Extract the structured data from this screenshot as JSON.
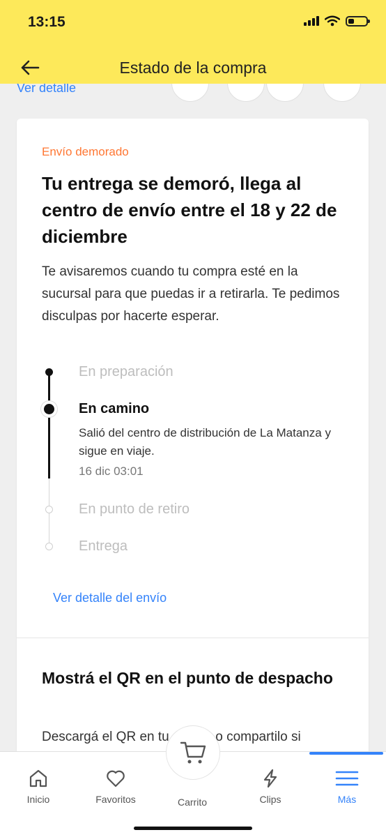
{
  "status_bar": {
    "time": "13:15"
  },
  "header": {
    "title": "Estado de la compra"
  },
  "top_strip": {
    "link": "Ver detalle"
  },
  "shipment": {
    "tag": "Envío demorado",
    "tag_color": "#ff7733",
    "headline": "Tu entrega se demoró, llega al centro de envío entre el 18 y 22 de diciembre",
    "description": "Te avisaremos cuando tu compra esté en la sucursal para que puedas ir a retirarla. Te pedimos disculpas por hacerte esperar.",
    "steps": [
      {
        "label": "En preparación",
        "state": "done"
      },
      {
        "label": "En camino",
        "state": "current",
        "detail": "Salió del centro de distribución de La Matanza y sigue en viaje.",
        "time": "16 dic 03:01"
      },
      {
        "label": "En punto de retiro",
        "state": "pending"
      },
      {
        "label": "Entrega",
        "state": "pending"
      }
    ],
    "detail_link": "Ver detalle del envío"
  },
  "qr_section": {
    "title": "Mostrá el QR en el punto de despacho",
    "description": "Descargá el QR en tu celular o compartilo si"
  },
  "bottom_nav": {
    "items": [
      {
        "label": "Inicio",
        "icon": "home-icon"
      },
      {
        "label": "Favoritos",
        "icon": "heart-icon"
      },
      {
        "label": "Carrito",
        "icon": "cart-icon"
      },
      {
        "label": "Clips",
        "icon": "lightning-icon"
      },
      {
        "label": "Más",
        "icon": "menu-icon",
        "active": true
      }
    ]
  },
  "colors": {
    "header": "#fde95a",
    "link": "#3483fa",
    "warning": "#ff7733"
  }
}
